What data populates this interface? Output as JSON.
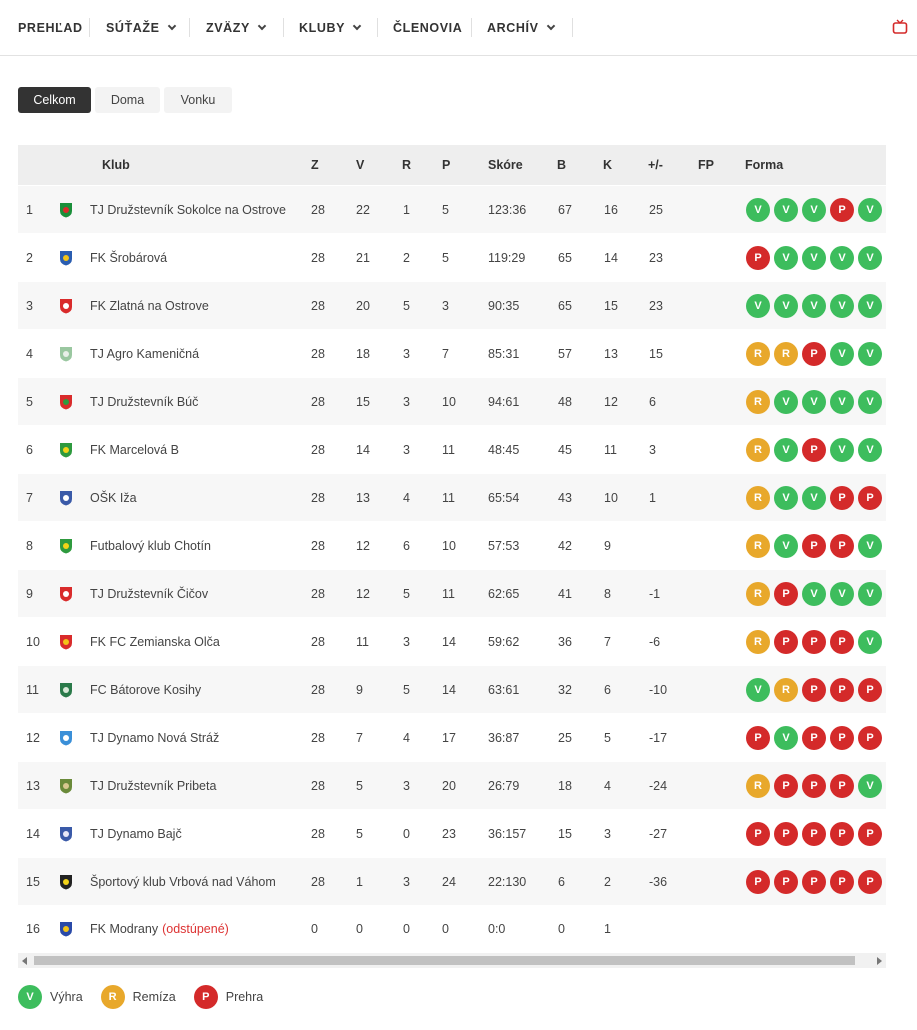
{
  "nav": {
    "items": [
      {
        "label": "PREHĽAD",
        "dropdown": false
      },
      {
        "label": "SÚŤAŽE",
        "dropdown": true
      },
      {
        "label": "ZVÄZY",
        "dropdown": true
      },
      {
        "label": "KLUBY",
        "dropdown": true
      },
      {
        "label": "ČLENOVIA",
        "dropdown": false
      },
      {
        "label": "ARCHÍV",
        "dropdown": true
      }
    ],
    "tv_icon": "tv-icon"
  },
  "tabs": [
    {
      "label": "Celkom",
      "active": true
    },
    {
      "label": "Doma",
      "active": false
    },
    {
      "label": "Vonku",
      "active": false
    }
  ],
  "table": {
    "headers": {
      "club": "Klub",
      "z": "Z",
      "v": "V",
      "r": "R",
      "p": "P",
      "score": "Skóre",
      "b": "B",
      "k": "K",
      "diff": "+/-",
      "fp": "FP",
      "form": "Forma"
    },
    "rows": [
      {
        "pos": "1",
        "club": "TJ Družstevník Sokolce na Ostrove",
        "z": "28",
        "v": "22",
        "r": "1",
        "p": "5",
        "score": "123:36",
        "b": "67",
        "k": "16",
        "diff": "25",
        "fp": "",
        "form": [
          "V",
          "V",
          "V",
          "P",
          "V"
        ],
        "crest": [
          "#1a8f3a",
          "#d92b2b"
        ]
      },
      {
        "pos": "2",
        "club": "FK Šrobárová",
        "z": "28",
        "v": "21",
        "r": "2",
        "p": "5",
        "score": "119:29",
        "b": "65",
        "k": "14",
        "diff": "23",
        "fp": "",
        "form": [
          "P",
          "V",
          "V",
          "V",
          "V"
        ],
        "crest": [
          "#2a5db0",
          "#f2c318"
        ]
      },
      {
        "pos": "3",
        "club": "FK Zlatná na Ostrove",
        "z": "28",
        "v": "20",
        "r": "5",
        "p": "3",
        "score": "90:35",
        "b": "65",
        "k": "15",
        "diff": "23",
        "fp": "",
        "form": [
          "V",
          "V",
          "V",
          "V",
          "V"
        ],
        "crest": [
          "#d92b2b",
          "#ffffff"
        ]
      },
      {
        "pos": "4",
        "club": "TJ Agro Kameničná",
        "z": "28",
        "v": "18",
        "r": "3",
        "p": "7",
        "score": "85:31",
        "b": "57",
        "k": "13",
        "diff": "15",
        "fp": "",
        "form": [
          "R",
          "R",
          "P",
          "V",
          "V"
        ],
        "crest": [
          "#9ac7a0",
          "#e8efe8"
        ]
      },
      {
        "pos": "5",
        "club": "TJ Družstevník Búč",
        "z": "28",
        "v": "15",
        "r": "3",
        "p": "10",
        "score": "94:61",
        "b": "48",
        "k": "12",
        "diff": "6",
        "fp": "",
        "form": [
          "R",
          "V",
          "V",
          "V",
          "V"
        ],
        "crest": [
          "#d92b2b",
          "#2e9a3e"
        ]
      },
      {
        "pos": "6",
        "club": "FK Marcelová B",
        "z": "28",
        "v": "14",
        "r": "3",
        "p": "11",
        "score": "48:45",
        "b": "45",
        "k": "11",
        "diff": "3",
        "fp": "",
        "form": [
          "R",
          "V",
          "P",
          "V",
          "V"
        ],
        "crest": [
          "#2e9a3e",
          "#f2d318"
        ]
      },
      {
        "pos": "7",
        "club": "OŠK Iža",
        "z": "28",
        "v": "13",
        "r": "4",
        "p": "11",
        "score": "65:54",
        "b": "43",
        "k": "10",
        "diff": "1",
        "fp": "",
        "form": [
          "R",
          "V",
          "V",
          "P",
          "P"
        ],
        "crest": [
          "#3a5aa8",
          "#ffffff"
        ]
      },
      {
        "pos": "8",
        "club": "Futbalový klub Chotín",
        "z": "28",
        "v": "12",
        "r": "6",
        "p": "10",
        "score": "57:53",
        "b": "42",
        "k": "9",
        "diff": "",
        "fp": "",
        "form": [
          "R",
          "V",
          "P",
          "P",
          "V"
        ],
        "crest": [
          "#2e9a3e",
          "#f2d318"
        ]
      },
      {
        "pos": "9",
        "club": "TJ Družstevník Čičov",
        "z": "28",
        "v": "12",
        "r": "5",
        "p": "11",
        "score": "62:65",
        "b": "41",
        "k": "8",
        "diff": "-1",
        "fp": "",
        "form": [
          "R",
          "P",
          "V",
          "V",
          "V"
        ],
        "crest": [
          "#d92b2b",
          "#ffffff"
        ]
      },
      {
        "pos": "10",
        "club": "FK FC Zemianska Olča",
        "z": "28",
        "v": "11",
        "r": "3",
        "p": "14",
        "score": "59:62",
        "b": "36",
        "k": "7",
        "diff": "-6",
        "fp": "",
        "form": [
          "R",
          "P",
          "P",
          "P",
          "V"
        ],
        "crest": [
          "#d92b2b",
          "#f2c318"
        ]
      },
      {
        "pos": "11",
        "club": "FC Bátorove Kosihy",
        "z": "28",
        "v": "9",
        "r": "5",
        "p": "14",
        "score": "63:61",
        "b": "32",
        "k": "6",
        "diff": "-10",
        "fp": "",
        "form": [
          "V",
          "R",
          "P",
          "P",
          "P"
        ],
        "crest": [
          "#2a7a4a",
          "#d8e8d8"
        ]
      },
      {
        "pos": "12",
        "club": "TJ Dynamo Nová Stráž",
        "z": "28",
        "v": "7",
        "r": "4",
        "p": "17",
        "score": "36:87",
        "b": "25",
        "k": "5",
        "diff": "-17",
        "fp": "",
        "form": [
          "P",
          "V",
          "P",
          "P",
          "P"
        ],
        "crest": [
          "#3a8fd8",
          "#ffffff"
        ]
      },
      {
        "pos": "13",
        "club": "TJ Družstevník Pribeta",
        "z": "28",
        "v": "5",
        "r": "3",
        "p": "20",
        "score": "26:79",
        "b": "18",
        "k": "4",
        "diff": "-24",
        "fp": "",
        "form": [
          "R",
          "P",
          "P",
          "P",
          "V"
        ],
        "crest": [
          "#6a8a3a",
          "#d8c890"
        ]
      },
      {
        "pos": "14",
        "club": "TJ Dynamo Bajč",
        "z": "28",
        "v": "5",
        "r": "0",
        "p": "23",
        "score": "36:157",
        "b": "15",
        "k": "3",
        "diff": "-27",
        "fp": "",
        "form": [
          "P",
          "P",
          "P",
          "P",
          "P"
        ],
        "crest": [
          "#3a5aa8",
          "#e8e8f8"
        ]
      },
      {
        "pos": "15",
        "club": "Športový klub Vrbová nad Váhom",
        "z": "28",
        "v": "1",
        "r": "3",
        "p": "24",
        "score": "22:130",
        "b": "6",
        "k": "2",
        "diff": "-36",
        "fp": "",
        "form": [
          "P",
          "P",
          "P",
          "P",
          "P"
        ],
        "crest": [
          "#222222",
          "#f2d318"
        ]
      },
      {
        "pos": "16",
        "club": "FK Modrany",
        "withdrawn": "(odstúpené)",
        "z": "0",
        "v": "0",
        "r": "0",
        "p": "0",
        "score": "0:0",
        "b": "0",
        "k": "1",
        "diff": "",
        "fp": "",
        "form": [],
        "crest": [
          "#2a4aa8",
          "#f2c318"
        ]
      }
    ]
  },
  "legend": [
    {
      "letter": "V",
      "label": "Výhra"
    },
    {
      "letter": "R",
      "label": "Remíza"
    },
    {
      "letter": "P",
      "label": "Prehra"
    }
  ],
  "colors": {
    "win": "#3dbd5d",
    "draw": "#e8a82b",
    "loss": "#d42a2a"
  }
}
